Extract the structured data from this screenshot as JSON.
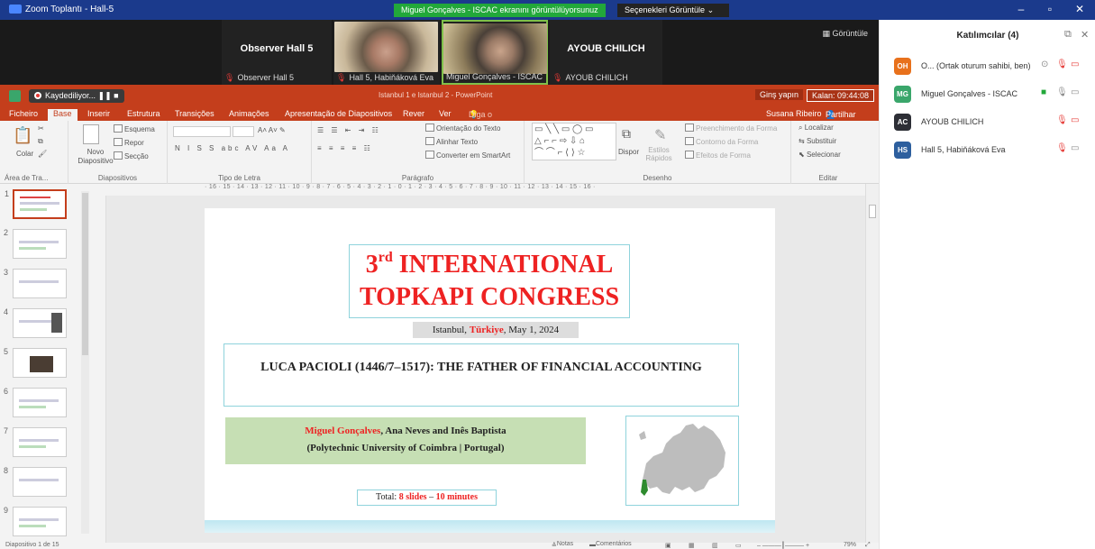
{
  "window": {
    "title": "Zoom Toplantı - Hall-5",
    "share_badge": "Miguel Gonçalves - ISCAC ekranını görüntülüyorsunuz",
    "view_options": "Seçenekleri Görüntüle"
  },
  "video_strip": {
    "view_label": "Görüntüle",
    "tiles": [
      {
        "name": "Observer Hall 5",
        "label": "Observer Hall 5"
      },
      {
        "name": "",
        "label": "Hall 5, Habiňáková Eva"
      },
      {
        "name": "",
        "label": "Miguel Gonçalves - ISCAC"
      },
      {
        "name": "AYOUB CHILICH",
        "label": "AYOUB CHILICH"
      }
    ]
  },
  "ppt": {
    "recording": "Kaydediliyor...",
    "doc_title": "Istanbul 1 e Istanbul 2 - PowerPoint",
    "login": "Ginş yapın",
    "remaining": "Kalan: 09:44:08",
    "tabs": [
      "Ficheiro",
      "Base",
      "Inserir",
      "Estrutura",
      "Transições",
      "Animações",
      "Apresentação de Diapositivos",
      "Rever",
      "Ver",
      "Diga o que pretende fazer..."
    ],
    "user": "Susana Ribeiro",
    "share": "Partilhar",
    "ribbon": {
      "paste": "Colar",
      "new_slide": "Novo Diapositivo",
      "layout": "Esquema",
      "reset": "Repor",
      "section": "Secção",
      "text_direction": "Orientação do Texto",
      "align_text": "Alinhar Texto",
      "smartart": "Converter em SmartArt",
      "arrange": "Dispor",
      "quick_styles": "Estilos Rápidos",
      "shape_fill": "Preenchimento da Forma",
      "shape_outline": "Contorno da Forma",
      "shape_effects": "Efeitos de Forma",
      "find": "Localizar",
      "replace": "Substituir",
      "select": "Selecionar",
      "groups": [
        "Área de Tra...",
        "Diapositivos",
        "Tipo de Letra",
        "Parágrafo",
        "Desenho",
        "Editar"
      ]
    },
    "ruler": "· 16 · 15 · 14 · 13 · 12 · 11 · 10 · 9 · 8 · 7 · 6 · 5 · 4 · 3 · 2 · 1 · 0 · 1 · 2 · 3 · 4 · 5 · 6 · 7 · 8 · 9 · 10 · 11 · 12 · 13 · 14 · 15 · 16 ·",
    "thumb_numbers": [
      "1",
      "2",
      "3",
      "4",
      "5",
      "6",
      "7",
      "8",
      "9"
    ],
    "slide": {
      "congress_ord": "3",
      "congress_sup": "rd",
      "congress_line1": " INTERNATIONAL",
      "congress_line2": "TOPKAPI CONGRESS",
      "place_a": "Istanbul, ",
      "place_b": "Türkiye",
      "place_c": ", May 1, 2024",
      "paper_title": "LUCA PACIOLI (1446/7–1517): THE FATHER OF FINANCIAL ACCOUNTING",
      "author_main": "Miguel Gonçalves",
      "author_rest": ", Ana Neves and Inês Baptista",
      "affiliation": "(Polytechnic University of Coimbra | Portugal)",
      "total_a": "Total: ",
      "total_b": "8 slides",
      "total_c": " – ",
      "total_d": "10 minutes"
    },
    "status": {
      "slide_count": "Diapositivo 1 de 15",
      "notes": "Notas",
      "comments": "Comentários",
      "zoom": "79%"
    }
  },
  "participants": {
    "header": "Katılımcılar (4)",
    "list": [
      {
        "initials": "OH",
        "color": "#e8711c",
        "name": "O... (Ortak oturum sahibi, ben)"
      },
      {
        "initials": "MG",
        "color": "#3aa66b",
        "name": "Miguel Gonçalves - ISCAC"
      },
      {
        "initials": "AC",
        "color": "#2d2f36",
        "name": "AYOUB CHILICH"
      },
      {
        "initials": "HS",
        "color": "#2d5f9e",
        "name": "Hall 5, Habiňáková Eva"
      }
    ]
  }
}
